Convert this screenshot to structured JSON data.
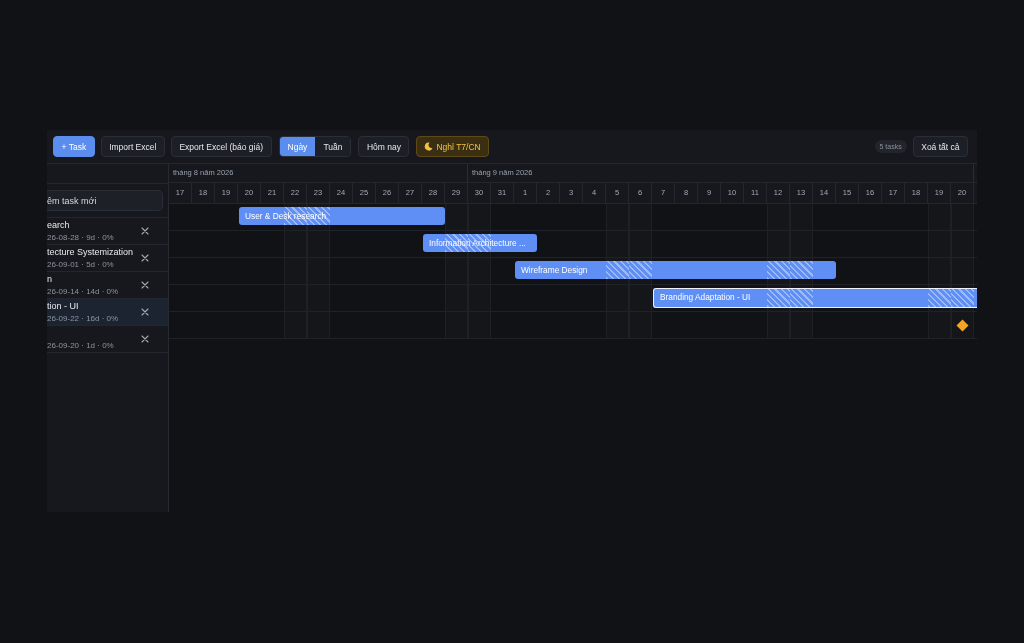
{
  "toolbar": {
    "buttons": [
      {
        "label": "+ Task",
        "kind": "primary"
      },
      {
        "label": "Import Excel",
        "kind": "default"
      },
      {
        "label": "Export Excel (báo giá)",
        "kind": "default"
      }
    ],
    "view_switch": [
      {
        "label": "Ngày",
        "selected": true
      },
      {
        "label": "Tuần",
        "selected": false
      }
    ],
    "today_button": "Hôm nay",
    "weekend_toggle": {
      "label": "Nghỉ T7/CN",
      "on": true
    },
    "task_count": "5 tasks",
    "clear_button": "Xoá tất cả"
  },
  "task_panel": {
    "new_task": {
      "placeholder": "êm task mới"
    },
    "tasks": [
      {
        "name": "earch",
        "meta": "26-08-28 · 9d · 0%",
        "selected": false
      },
      {
        "name": "tecture Systemization",
        "meta": "26-09-01 · 5d · 0%",
        "selected": false
      },
      {
        "name": "n",
        "meta": "26-09-14 · 14d · 0%",
        "selected": false
      },
      {
        "name": "tion - UI",
        "meta": "26-09-22 · 16d · 0%",
        "selected": true
      },
      {
        "meta": "26-09-20 · 1d · 0%",
        "selected": false
      }
    ]
  },
  "timeline": {
    "months": [
      {
        "label": "tháng 8 năm 2026",
        "days": [
          {
            "label": "17",
            "weekend": false
          },
          {
            "label": "18",
            "weekend": false
          },
          {
            "label": "19",
            "weekend": false
          },
          {
            "label": "20",
            "weekend": false
          },
          {
            "label": "21",
            "weekend": false
          },
          {
            "label": "22",
            "weekend": true
          },
          {
            "label": "23",
            "weekend": true
          },
          {
            "label": "24",
            "weekend": false
          },
          {
            "label": "25",
            "weekend": false
          },
          {
            "label": "26",
            "weekend": false
          },
          {
            "label": "27",
            "weekend": false
          },
          {
            "label": "28",
            "weekend": false
          },
          {
            "label": "29",
            "weekend": true
          }
        ]
      },
      {
        "label": "tháng 9 năm 2026",
        "days": [
          {
            "label": "30",
            "weekend": true
          },
          {
            "label": "31",
            "weekend": false
          },
          {
            "label": "1",
            "weekend": false
          },
          {
            "label": "2",
            "weekend": false
          },
          {
            "label": "3",
            "weekend": false
          },
          {
            "label": "4",
            "weekend": false
          },
          {
            "label": "5",
            "weekend": true
          },
          {
            "label": "6",
            "weekend": true
          },
          {
            "label": "7",
            "weekend": false
          },
          {
            "label": "8",
            "weekend": false
          },
          {
            "label": "9",
            "weekend": false
          },
          {
            "label": "10",
            "weekend": false
          },
          {
            "label": "11",
            "weekend": false
          },
          {
            "label": "12",
            "weekend": true
          },
          {
            "label": "13",
            "weekend": true
          },
          {
            "label": "14",
            "weekend": false
          },
          {
            "label": "15",
            "weekend": false
          },
          {
            "label": "16",
            "weekend": false
          },
          {
            "label": "17",
            "weekend": false
          },
          {
            "label": "18",
            "weekend": false
          },
          {
            "label": "19",
            "weekend": true
          },
          {
            "label": "20",
            "weekend": true
          }
        ]
      }
    ],
    "rows": [
      {
        "label": "User & Desk research",
        "selected": false,
        "cells": [
          {
            "kind": "empty"
          },
          {
            "kind": "empty"
          },
          {
            "kind": "empty"
          },
          {
            "kind": "bar"
          },
          {
            "kind": "bar"
          },
          {
            "kind": "bar"
          },
          {
            "kind": "bar"
          },
          {
            "kind": "bar"
          },
          {
            "kind": "bar"
          },
          {
            "kind": "bar"
          },
          {
            "kind": "bar"
          },
          {
            "kind": "bar"
          },
          {
            "kind": "empty"
          },
          {
            "kind": "empty"
          },
          {
            "kind": "empty"
          },
          {
            "kind": "empty"
          },
          {
            "kind": "empty"
          },
          {
            "kind": "empty"
          },
          {
            "kind": "empty"
          },
          {
            "kind": "empty"
          },
          {
            "kind": "empty"
          },
          {
            "kind": "empty"
          },
          {
            "kind": "empty"
          },
          {
            "kind": "empty"
          },
          {
            "kind": "empty"
          },
          {
            "kind": "empty"
          },
          {
            "kind": "empty"
          },
          {
            "kind": "empty"
          },
          {
            "kind": "empty"
          },
          {
            "kind": "empty"
          },
          {
            "kind": "empty"
          },
          {
            "kind": "empty"
          },
          {
            "kind": "empty"
          },
          {
            "kind": "empty"
          },
          {
            "kind": "empty"
          }
        ]
      },
      {
        "label": "Information Architecture ...",
        "selected": false,
        "cells": [
          {
            "kind": "empty"
          },
          {
            "kind": "empty"
          },
          {
            "kind": "empty"
          },
          {
            "kind": "empty"
          },
          {
            "kind": "empty"
          },
          {
            "kind": "empty"
          },
          {
            "kind": "empty"
          },
          {
            "kind": "empty"
          },
          {
            "kind": "empty"
          },
          {
            "kind": "empty"
          },
          {
            "kind": "empty"
          },
          {
            "kind": "bar"
          },
          {
            "kind": "bar"
          },
          {
            "kind": "bar"
          },
          {
            "kind": "bar"
          },
          {
            "kind": "bar"
          },
          {
            "kind": "empty"
          },
          {
            "kind": "empty"
          },
          {
            "kind": "empty"
          },
          {
            "kind": "empty"
          },
          {
            "kind": "empty"
          },
          {
            "kind": "empty"
          },
          {
            "kind": "empty"
          },
          {
            "kind": "empty"
          },
          {
            "kind": "empty"
          },
          {
            "kind": "empty"
          },
          {
            "kind": "empty"
          },
          {
            "kind": "empty"
          },
          {
            "kind": "empty"
          },
          {
            "kind": "empty"
          },
          {
            "kind": "empty"
          },
          {
            "kind": "empty"
          },
          {
            "kind": "empty"
          },
          {
            "kind": "empty"
          },
          {
            "kind": "empty"
          }
        ]
      },
      {
        "label": "Wireframe Design",
        "selected": false,
        "cells": [
          {
            "kind": "empty"
          },
          {
            "kind": "empty"
          },
          {
            "kind": "empty"
          },
          {
            "kind": "empty"
          },
          {
            "kind": "empty"
          },
          {
            "kind": "empty"
          },
          {
            "kind": "empty"
          },
          {
            "kind": "empty"
          },
          {
            "kind": "empty"
          },
          {
            "kind": "empty"
          },
          {
            "kind": "empty"
          },
          {
            "kind": "empty"
          },
          {
            "kind": "empty"
          },
          {
            "kind": "empty"
          },
          {
            "kind": "empty"
          },
          {
            "kind": "bar"
          },
          {
            "kind": "bar"
          },
          {
            "kind": "bar"
          },
          {
            "kind": "bar"
          },
          {
            "kind": "bar"
          },
          {
            "kind": "bar"
          },
          {
            "kind": "bar"
          },
          {
            "kind": "bar"
          },
          {
            "kind": "bar"
          },
          {
            "kind": "bar"
          },
          {
            "kind": "bar"
          },
          {
            "kind": "bar"
          },
          {
            "kind": "bar"
          },
          {
            "kind": "bar"
          },
          {
            "kind": "empty"
          },
          {
            "kind": "empty"
          },
          {
            "kind": "empty"
          },
          {
            "kind": "empty"
          },
          {
            "kind": "empty"
          },
          {
            "kind": "empty"
          }
        ]
      },
      {
        "label": "Branding Adaptation - UI",
        "selected": true,
        "cells": [
          {
            "kind": "empty"
          },
          {
            "kind": "empty"
          },
          {
            "kind": "empty"
          },
          {
            "kind": "empty"
          },
          {
            "kind": "empty"
          },
          {
            "kind": "empty"
          },
          {
            "kind": "empty"
          },
          {
            "kind": "empty"
          },
          {
            "kind": "empty"
          },
          {
            "kind": "empty"
          },
          {
            "kind": "empty"
          },
          {
            "kind": "empty"
          },
          {
            "kind": "empty"
          },
          {
            "kind": "empty"
          },
          {
            "kind": "empty"
          },
          {
            "kind": "empty"
          },
          {
            "kind": "empty"
          },
          {
            "kind": "empty"
          },
          {
            "kind": "empty"
          },
          {
            "kind": "empty"
          },
          {
            "kind": "empty"
          },
          {
            "kind": "bar"
          },
          {
            "kind": "bar"
          },
          {
            "kind": "bar"
          },
          {
            "kind": "bar"
          },
          {
            "kind": "bar"
          },
          {
            "kind": "bar"
          },
          {
            "kind": "bar"
          },
          {
            "kind": "bar"
          },
          {
            "kind": "bar"
          },
          {
            "kind": "bar"
          },
          {
            "kind": "bar"
          },
          {
            "kind": "bar"
          },
          {
            "kind": "bar"
          },
          {
            "kind": "bar"
          }
        ]
      },
      {
        "selected": false,
        "cells": [
          {
            "kind": "empty"
          },
          {
            "kind": "empty"
          },
          {
            "kind": "empty"
          },
          {
            "kind": "empty"
          },
          {
            "kind": "empty"
          },
          {
            "kind": "empty"
          },
          {
            "kind": "empty"
          },
          {
            "kind": "empty"
          },
          {
            "kind": "empty"
          },
          {
            "kind": "empty"
          },
          {
            "kind": "empty"
          },
          {
            "kind": "empty"
          },
          {
            "kind": "empty"
          },
          {
            "kind": "empty"
          },
          {
            "kind": "empty"
          },
          {
            "kind": "empty"
          },
          {
            "kind": "empty"
          },
          {
            "kind": "empty"
          },
          {
            "kind": "empty"
          },
          {
            "kind": "empty"
          },
          {
            "kind": "empty"
          },
          {
            "kind": "empty"
          },
          {
            "kind": "empty"
          },
          {
            "kind": "empty"
          },
          {
            "kind": "empty"
          },
          {
            "kind": "empty"
          },
          {
            "kind": "empty"
          },
          {
            "kind": "empty"
          },
          {
            "kind": "empty"
          },
          {
            "kind": "empty"
          },
          {
            "kind": "empty"
          },
          {
            "kind": "empty"
          },
          {
            "kind": "empty"
          },
          {
            "kind": "empty"
          },
          {
            "kind": "milestone"
          }
        ]
      }
    ]
  }
}
